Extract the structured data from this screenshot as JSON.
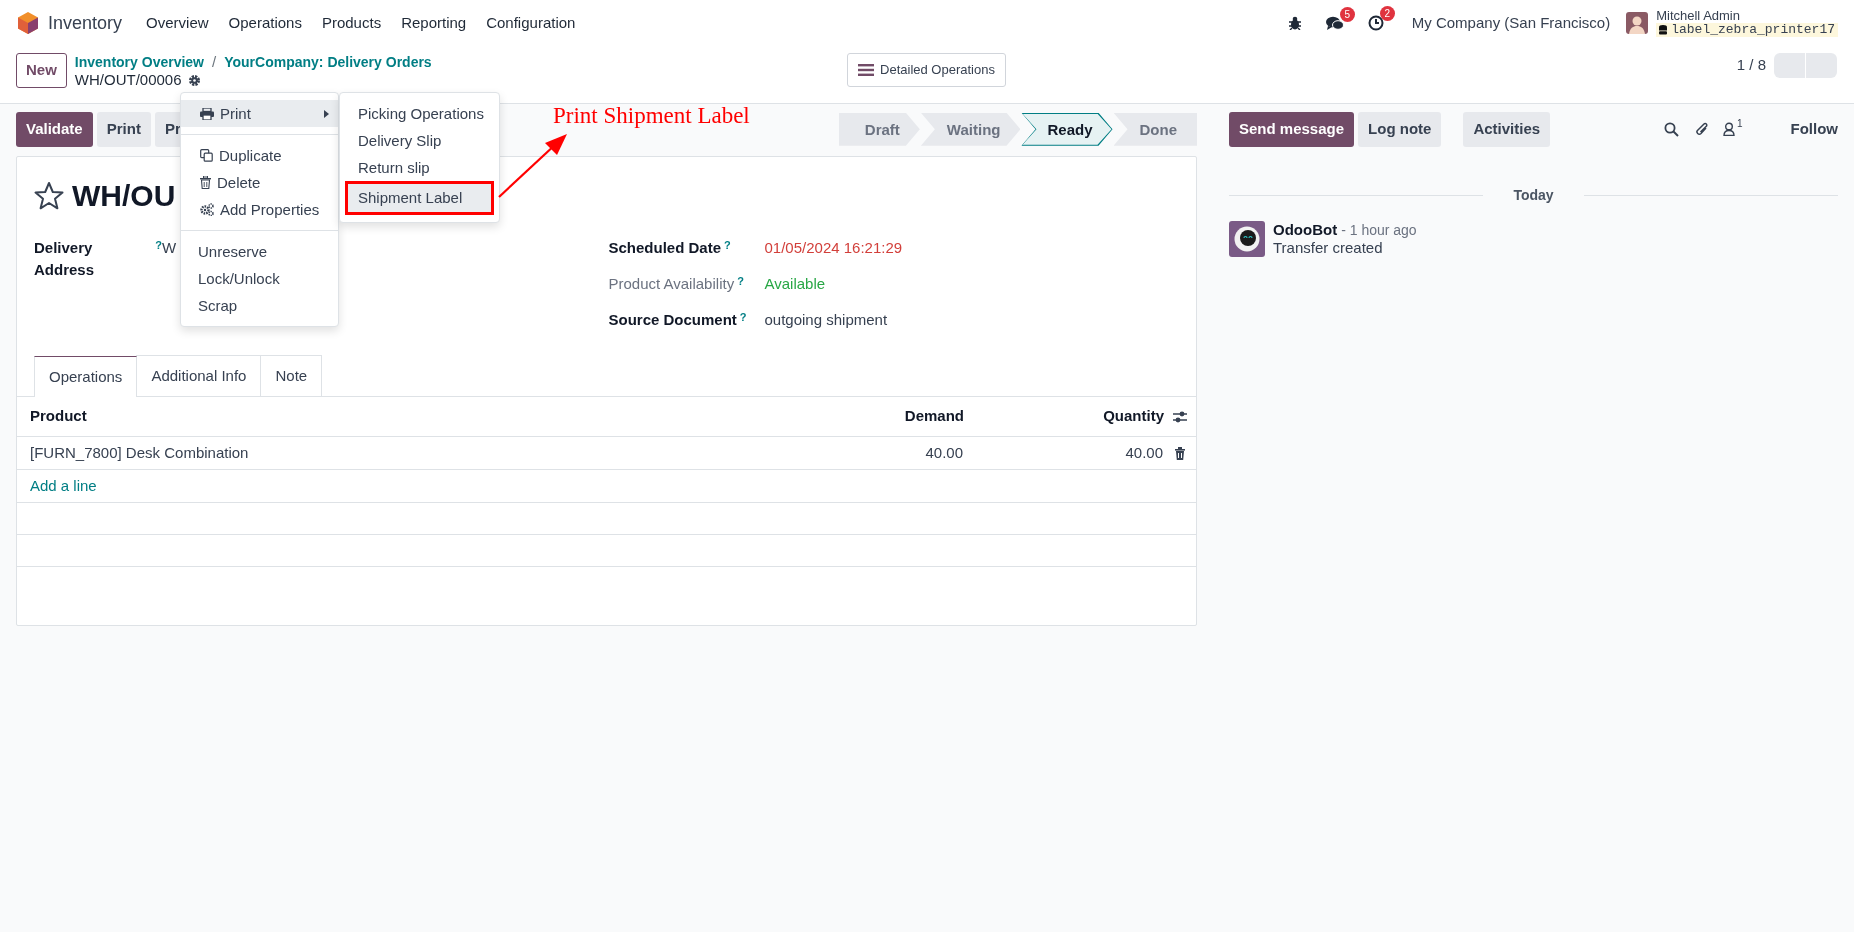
{
  "navbar": {
    "app": "Inventory",
    "menus": [
      "Overview",
      "Operations",
      "Products",
      "Reporting",
      "Configuration"
    ],
    "systray": [
      {
        "kind": "debug"
      },
      {
        "kind": "messages",
        "badge": "5"
      },
      {
        "kind": "activities",
        "badge": "2"
      }
    ],
    "company": "My Company (San Francisco)",
    "user": {
      "name": "Mitchell Admin",
      "database": "label_zebra_printer17"
    }
  },
  "control_panel": {
    "new_button": "New",
    "breadcrumbs": [
      "Inventory Overview",
      "YourCompany: Delivery Orders"
    ],
    "breadcrumb_separator": "/",
    "record_name": "WH/OUT/00006",
    "view_button": "Detailed Operations",
    "pager": "1 / 8"
  },
  "action_buttons": [
    {
      "label": "Validate",
      "primary": true
    },
    {
      "label": "Print",
      "primary": false
    },
    {
      "label": "Pr",
      "primary": false
    }
  ],
  "status_steps": [
    {
      "label": "Draft",
      "selected": false
    },
    {
      "label": "Waiting",
      "selected": false
    },
    {
      "label": "Ready",
      "selected": true
    },
    {
      "label": "Done",
      "selected": false
    }
  ],
  "form": {
    "starred": false,
    "title": "WH/OU",
    "left_fields": [
      {
        "label": "Delivery Address",
        "help": "?",
        "value": "W",
        "muted": false,
        "color": "#374151"
      }
    ],
    "right_fields": [
      {
        "label": "Scheduled Date",
        "help": "?",
        "value": "01/05/2024 16:21:29",
        "muted": false,
        "color": "#d23f3a"
      },
      {
        "label": "Product Availability",
        "help": "?",
        "value": "Available",
        "muted": true,
        "color": "#28a745"
      },
      {
        "label": "Source Document",
        "help": "?",
        "value": "outgoing shipment",
        "muted": false,
        "color": "#374151"
      }
    ],
    "tabs": [
      {
        "label": "Operations",
        "selected": true
      },
      {
        "label": "Additional Info",
        "selected": false
      },
      {
        "label": "Note",
        "selected": false
      }
    ],
    "table": {
      "columns": [
        {
          "label": "Product"
        },
        {
          "label": "Demand"
        },
        {
          "label": "Quantity"
        }
      ],
      "rows": [
        {
          "cells": [
            "[FURN_7800] Desk Combination",
            "40.00",
            "40.00"
          ]
        }
      ],
      "add_line": "Add a line"
    }
  },
  "gear_menu": {
    "sections": [
      {
        "items": [
          {
            "kind": "submenu",
            "label": "Print",
            "selected": true
          }
        ]
      },
      {
        "items": [
          {
            "kind": "copy",
            "label": "Duplicate",
            "selected": false
          },
          {
            "kind": "trash",
            "label": "Delete",
            "selected": false
          },
          {
            "kind": "gears",
            "label": "Add Properties",
            "selected": false
          }
        ]
      },
      {
        "items": [
          {
            "kind": "plain",
            "label": "Unreserve",
            "selected": false
          },
          {
            "kind": "plain",
            "label": "Lock/Unlock",
            "selected": false
          },
          {
            "kind": "plain",
            "label": "Scrap",
            "selected": false
          }
        ]
      }
    ],
    "submenu": [
      {
        "label": "Picking Operations",
        "selected": false
      },
      {
        "label": "Delivery Slip",
        "selected": false
      },
      {
        "label": "Return slip",
        "selected": false
      },
      {
        "label": "Shipment Label",
        "selected": true
      }
    ]
  },
  "annotation": {
    "text": "Print Shipment Label"
  },
  "chatter": {
    "composer_buttons": [
      {
        "label": "Send message",
        "primary": true
      },
      {
        "label": "Log note",
        "primary": false
      }
    ],
    "activities_button": "Activities",
    "followers_count": "1",
    "follow": "Follow",
    "date_separator": "Today",
    "messages": [
      {
        "author": "OdooBot",
        "time": "- 1 hour ago",
        "body": "Transfer created"
      }
    ]
  }
}
